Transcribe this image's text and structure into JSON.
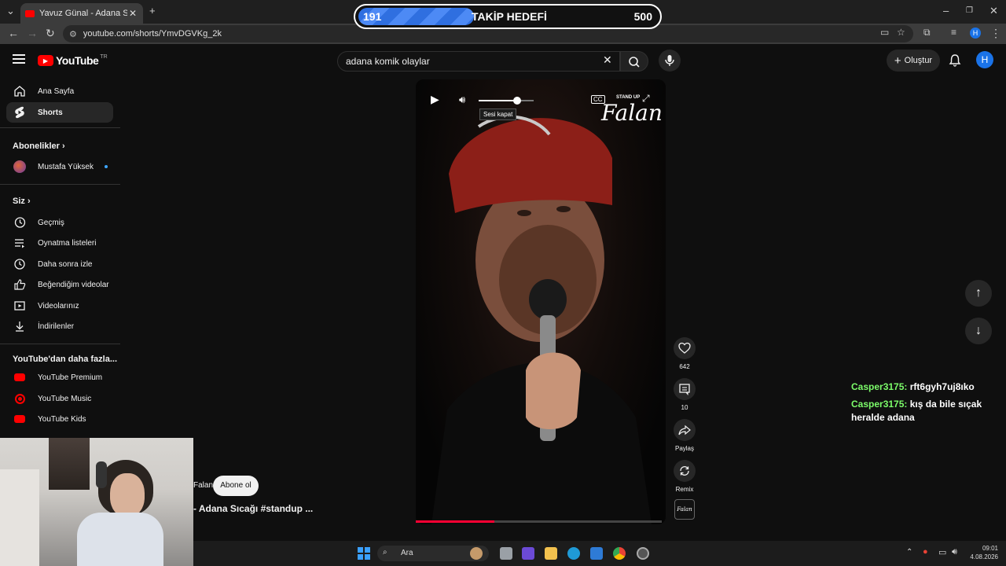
{
  "browser": {
    "tab_title": "Yavuz Günal - Adana Sıcağı #st...",
    "url": "youtube.com/shorts/YmvDGVKg_2k"
  },
  "goal_overlay": {
    "current": "191",
    "label": "TAKİP HEDEFİ",
    "target": "500",
    "progress_fraction": 0.382
  },
  "header": {
    "logo_text": "YouTube",
    "region": "TR",
    "search_value": "adana komik olaylar",
    "create_label": "Oluştur",
    "avatar_letter": "H"
  },
  "sidebar": {
    "home": "Ana Sayfa",
    "shorts": "Shorts",
    "subscriptions_heading": "Abonelikler",
    "subscription_channel": "Mustafa Yüksek",
    "you_heading": "Siz",
    "you_items": [
      "Geçmiş",
      "Oynatma listeleri",
      "Daha sonra izle",
      "Beğendiğim videolar",
      "Videolarınız",
      "İndirilenler"
    ],
    "more_heading": "YouTube'dan daha fazla...",
    "more_items": [
      "YouTube Premium",
      "YouTube Music",
      "YouTube Kids"
    ]
  },
  "player": {
    "tooltip": "Sesi kapat",
    "watermark_small": "STAND UP",
    "watermark": "Falan",
    "volume_level": 0.7,
    "progress_fraction": 0.32,
    "channel_partial": "Falan",
    "subscribe_label": "Abone ol",
    "video_title_partial": "- Adana Sıcağı  #standup ..."
  },
  "actions": {
    "likes": "642",
    "comments": "10",
    "share_label": "Paylaş",
    "remix_label": "Remix",
    "channel_thumb_text": "Falan"
  },
  "chat": [
    {
      "user": "Casper3175:",
      "message": "rft6gyh7uj8ıko"
    },
    {
      "user": "Casper3175:",
      "message": "kış da bile sıçak heralde adana"
    }
  ],
  "taskbar": {
    "search_placeholder": "Ara",
    "time": "09:01",
    "date": "4.08.2026"
  }
}
